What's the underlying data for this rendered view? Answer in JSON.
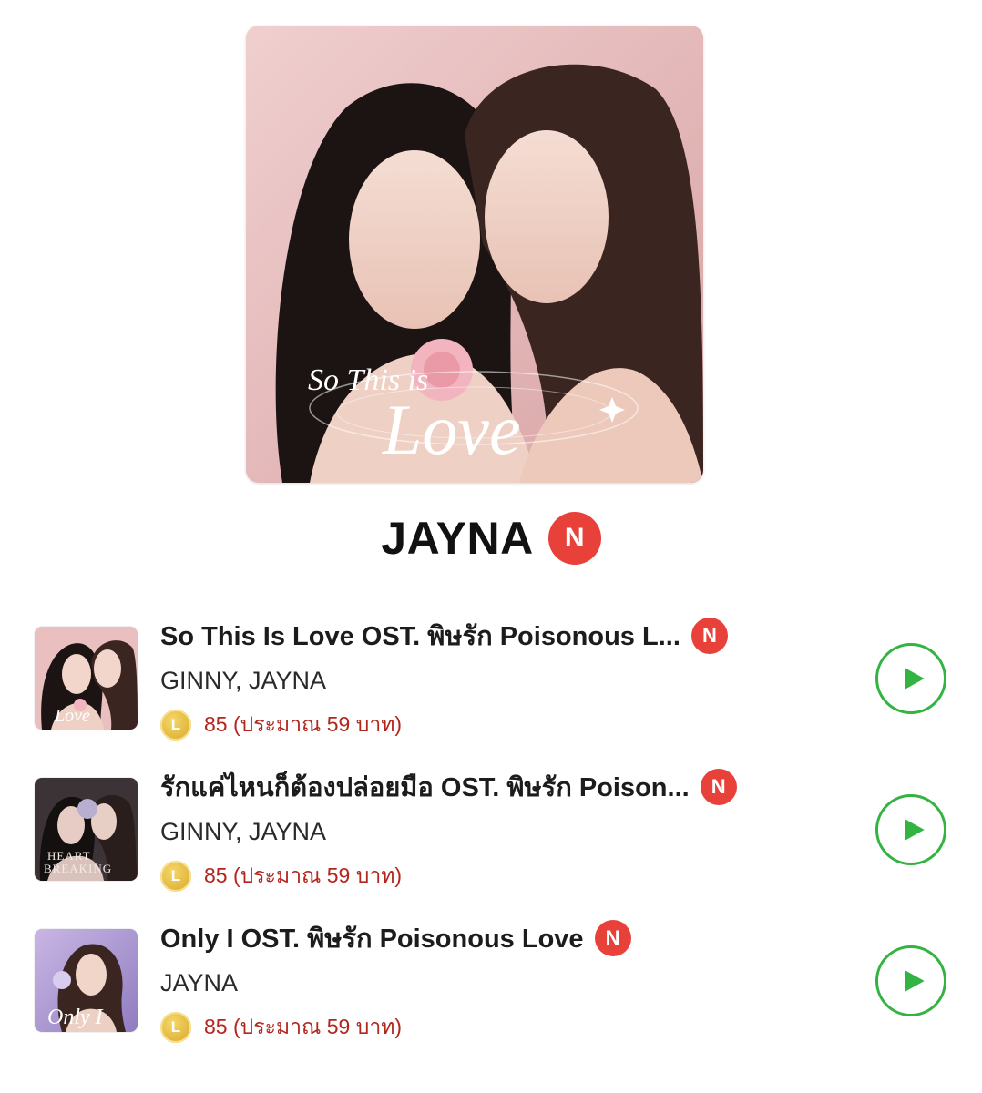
{
  "album": {
    "cover_text_line1": "So This is",
    "cover_text_line2": "Love",
    "artist": "JAYNA",
    "badge": "N"
  },
  "tracks": [
    {
      "title": "So This Is Love OST. พิษรัก Poisonous L...",
      "badge": "N",
      "artists": "GINNY, JAYNA",
      "coin_label": "L",
      "price": "85 (ประมาณ 59 บาท)",
      "thumb_style": "pink"
    },
    {
      "title": "รักแค่ไหนก็ต้องปล่อยมือ OST. พิษรัก Poison...",
      "badge": "N",
      "artists": "GINNY, JAYNA",
      "coin_label": "L",
      "price": "85 (ประมาณ 59 บาท)",
      "thumb_style": "dark",
      "thumb_text": "HEART BREAKING"
    },
    {
      "title": "Only I OST. พิษรัก Poisonous Love",
      "badge": "N",
      "artists": "JAYNA",
      "coin_label": "L",
      "price": "85 (ประมาณ 59 บาท)",
      "thumb_style": "violet",
      "thumb_text": "Only I"
    }
  ],
  "colors": {
    "badge_red": "#e8413a",
    "play_green": "#33b341",
    "price_red": "#b3261e",
    "coin_gold": "#e1b43a"
  },
  "icons": {
    "play": "play-triangle-icon",
    "coin": "line-coin-icon",
    "new": "new-badge-icon"
  }
}
